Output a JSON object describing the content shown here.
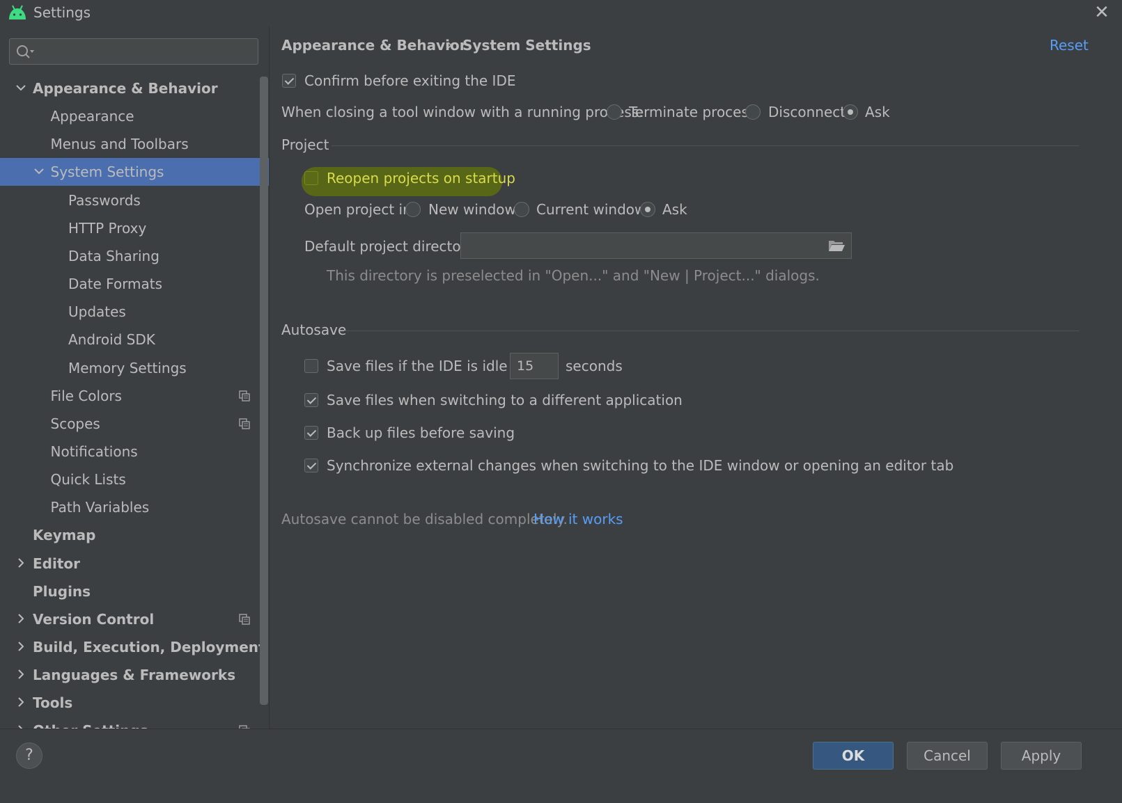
{
  "window": {
    "title": "Settings",
    "close_glyph": "✕"
  },
  "search": {
    "placeholder": "",
    "value": ""
  },
  "sidebar": {
    "items": [
      {
        "label": "Appearance & Behavior",
        "expanded": true
      },
      {
        "label": "Appearance"
      },
      {
        "label": "Menus and Toolbars"
      },
      {
        "label": "System Settings",
        "expanded": true,
        "selected": true
      },
      {
        "label": "Passwords"
      },
      {
        "label": "HTTP Proxy"
      },
      {
        "label": "Data Sharing"
      },
      {
        "label": "Date Formats"
      },
      {
        "label": "Updates"
      },
      {
        "label": "Android SDK"
      },
      {
        "label": "Memory Settings"
      },
      {
        "label": "File Colors",
        "project_icon": true
      },
      {
        "label": "Scopes",
        "project_icon": true
      },
      {
        "label": "Notifications"
      },
      {
        "label": "Quick Lists"
      },
      {
        "label": "Path Variables"
      },
      {
        "label": "Keymap"
      },
      {
        "label": "Editor",
        "collapsed": true
      },
      {
        "label": "Plugins"
      },
      {
        "label": "Version Control",
        "collapsed": true,
        "project_icon": true
      },
      {
        "label": "Build, Execution, Deployment",
        "collapsed": true
      },
      {
        "label": "Languages & Frameworks",
        "collapsed": true
      },
      {
        "label": "Tools",
        "collapsed": true
      },
      {
        "label": "Other Settings",
        "collapsed": true,
        "project_icon": true
      }
    ]
  },
  "breadcrumb": {
    "parent": "Appearance & Behavior",
    "separator": "›",
    "current": "System Settings",
    "reset_label": "Reset"
  },
  "general": {
    "confirm_exit": {
      "label": "Confirm before exiting the IDE",
      "checked": true
    },
    "closing_tool_window": {
      "label": "When closing a tool window with a running process:",
      "options": [
        "Terminate process",
        "Disconnect",
        "Ask"
      ],
      "selected": "Ask"
    }
  },
  "project": {
    "section_title": "Project",
    "reopen": {
      "label": "Reopen projects on startup",
      "checked": false
    },
    "open_in": {
      "label": "Open project in",
      "options": [
        "New window",
        "Current window",
        "Ask"
      ],
      "selected": "Ask"
    },
    "default_dir": {
      "label": "Default project directory:",
      "value": ""
    },
    "hint": "This directory is preselected in \"Open...\" and \"New | Project...\" dialogs."
  },
  "autosave": {
    "section_title": "Autosave",
    "idle": {
      "label": "Save files if the IDE is idle for",
      "value": "15",
      "suffix": "seconds",
      "checked": false
    },
    "switch_app": {
      "label": "Save files when switching to a different application",
      "checked": true
    },
    "backup": {
      "label": "Back up files before saving",
      "checked": true
    },
    "sync": {
      "label": "Synchronize external changes when switching to the IDE window or opening an editor tab",
      "checked": true
    },
    "note": "Autosave cannot be disabled completely.",
    "note_link": "How it works"
  },
  "footer": {
    "help": "?",
    "ok": "OK",
    "cancel": "Cancel",
    "apply": "Apply"
  },
  "colors": {
    "background": "#3c3f41",
    "selection": "#4b6eaf",
    "link": "#589df6",
    "highlight": "#5d6d12",
    "android_green": "#3ddc84"
  }
}
